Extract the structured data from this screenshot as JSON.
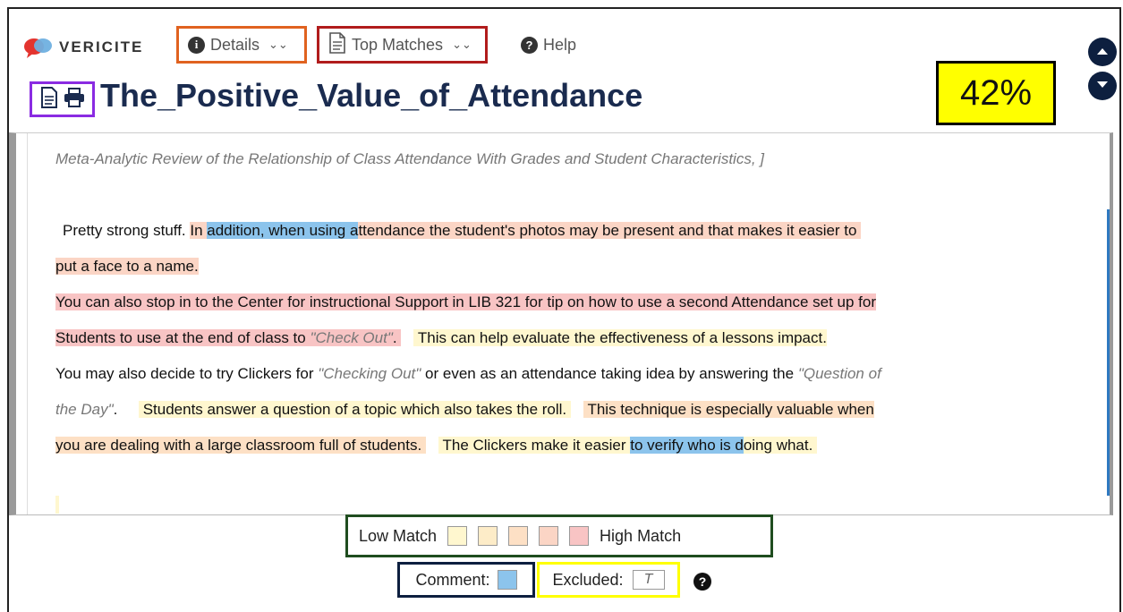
{
  "app": {
    "brand": "VERICITE"
  },
  "nav": {
    "details_label": "Details",
    "top_matches_label": "Top Matches",
    "help_label": "Help"
  },
  "document": {
    "title": "The_Positive_Value_of_Attendance",
    "score": "42%",
    "lines": {
      "l0": "Meta-Analytic Review of the Relationship of Class Attendance With Grades and Student Characteristics, ]",
      "l1a": "Pretty strong stuff. ",
      "l1b": "In ",
      "l1c": "addition, when using a",
      "l1d": "ttendance the student's photos may be present and that makes it easier to",
      "l2": "put a face to a name.",
      "l3": " You can also stop in to the Center for instructional Support in LIB 321 for tip on how to use a second Attendance set up for",
      "l4a": "Students to use at the end of class to ",
      "l4b": "\"Check Out\"",
      "l4c": ". ",
      "l4d": " This can help evaluate the effectiveness of a lessons impact.",
      "l5a": " You may also decide to try Clickers for ",
      "l5b": "\"Checking Out\"",
      "l5c": " or even as an attendance taking idea by answering the ",
      "l5d": "\"Question of",
      "l6a": "the Day\"",
      "l6b": ". ",
      "l6c": " Students answer a question of a topic which also takes the roll. ",
      "l6d": " This technique is especially valuable when",
      "l7a": "you are dealing with a large classroom full of students. ",
      "l7b": " The Clickers make it easier ",
      "l7c": "to verify who is d",
      "l7d": "oing what."
    }
  },
  "legend": {
    "low_label": "Low Match",
    "high_label": "High Match",
    "swatches": [
      "#fff7cf",
      "#fdecc8",
      "#fde0c5",
      "#fbd5c5",
      "#f8c4c4"
    ],
    "comment_label": "Comment:",
    "comment_color": "#8cc4ec",
    "excluded_label": "Excluded:",
    "excluded_sample": "T"
  }
}
